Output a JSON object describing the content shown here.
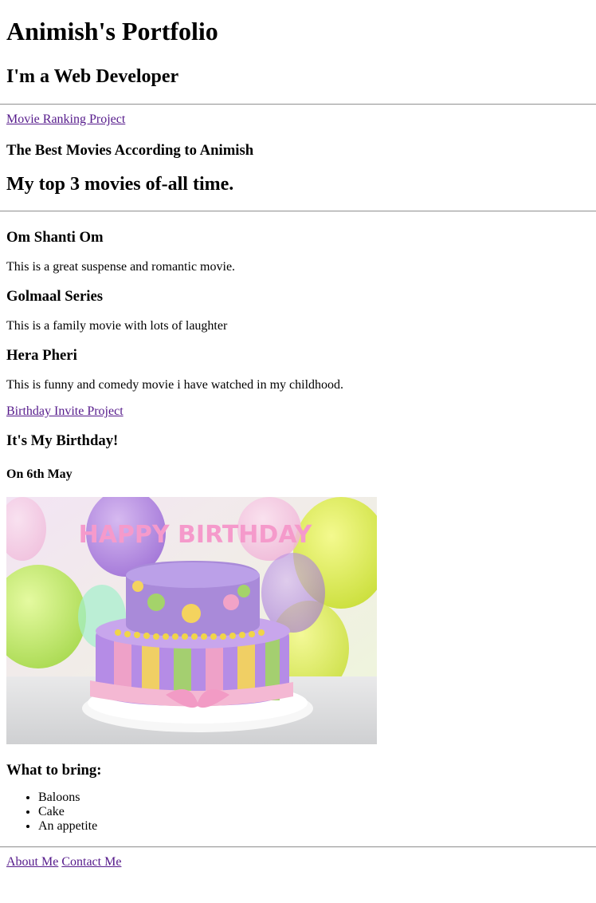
{
  "header": {
    "title": "Animish's Portfolio",
    "subtitle": "I'm a Web Developer"
  },
  "movie_section": {
    "link_label": "Movie Ranking Project",
    "heading": "The Best Movies According to Animish",
    "subheading": "My top 3 movies of-all time.",
    "movies": [
      {
        "title": "Om Shanti Om",
        "description": "This is a great suspense and romantic movie."
      },
      {
        "title": "Golmaal Series",
        "description": "This is a family movie with lots of laughter"
      },
      {
        "title": "Hera Pheri",
        "description": "This is funny and comedy movie i have watched in my childhood."
      }
    ]
  },
  "birthday_section": {
    "link_label": "Birthday Invite Project",
    "heading": "It's My Birthday!",
    "date": "On 6th May",
    "image_text": "HAPPY BIRTHDAY",
    "bring_heading": "What to bring:",
    "bring_items": [
      "Baloons",
      "Cake",
      "An appetite"
    ]
  },
  "footer": {
    "about_label": "About Me",
    "contact_label": "Contact Me"
  },
  "colors": {
    "link": "#551a8b",
    "rule": "#9a9a9a"
  }
}
